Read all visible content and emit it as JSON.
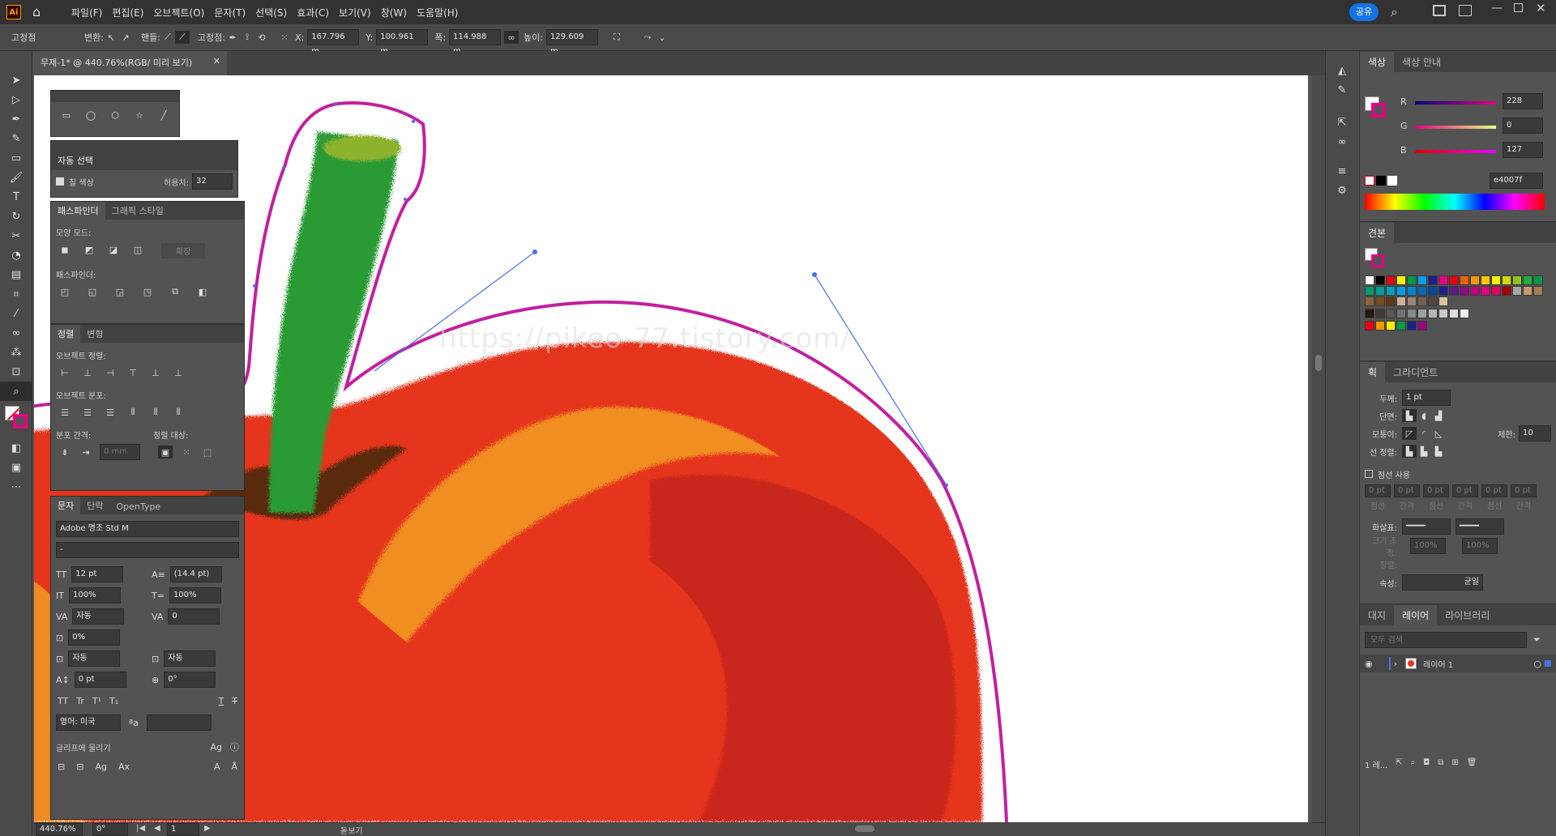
{
  "menubar": {
    "app_icon": "Ai",
    "items": [
      "파일(F)",
      "편집(E)",
      "오브젝트(O)",
      "문자(T)",
      "선택(S)",
      "효과(C)",
      "보기(V)",
      "창(W)",
      "도움말(H)"
    ],
    "share_label": "공유"
  },
  "control": {
    "mode": "고정점",
    "convert_label": "변환:",
    "handles_label": "핸들:",
    "anchor_label": "고정점:",
    "x_label": "X:",
    "x_value": "167.796 m",
    "y_label": "Y:",
    "y_value": "100.961 m",
    "w_label": "폭:",
    "w_value": "114.988 m",
    "h_label": "높이:",
    "h_value": "129.609 m"
  },
  "document": {
    "tab_title": "무제-1* @ 440.76%(RGB/ 미리 보기)",
    "watermark": "https://pikeo-77.tistory.com/"
  },
  "autoselect": {
    "title": "자동 선택",
    "fill_label": "칠 색상",
    "tolerance_label": "허용치:",
    "tolerance_value": "32"
  },
  "pathfinder": {
    "tab1": "패스파인더",
    "tab2": "그래픽 스타일",
    "shape_modes": "모양 모드:",
    "expand": "확장",
    "pathfinders": "패스파인더:"
  },
  "align": {
    "tab1": "정렬",
    "tab2": "변형",
    "align_objects": "오브젝트 정렬:",
    "distribute_objects": "오브젝트 분포:",
    "distribute_spacing": "분포 간격:",
    "align_to": "정렬 대상:",
    "spacing_value": "0 mm"
  },
  "character": {
    "tab1": "문자",
    "tab2": "단락",
    "tab3": "OpenType",
    "font_family": "Adobe 명조 Std M",
    "font_style": "-",
    "size": "12 pt",
    "leading": "(14.4 pt)",
    "v_scale": "100%",
    "h_scale": "100%",
    "kerning": "자동",
    "tracking": "0",
    "tsume": "0%",
    "aki_left": "자동",
    "aki_right": "자동",
    "baseline": "0 pt",
    "rotation": "0°",
    "language": "영어: 미국",
    "snap_label": "글리프에 물리기"
  },
  "status": {
    "zoom": "440.76%",
    "rotate": "0°",
    "artboard": "1",
    "tool_name": "돋보기"
  },
  "color_panel": {
    "tab1": "색상",
    "tab2": "색상 안내",
    "r_label": "R",
    "r_value": "228",
    "g_label": "G",
    "g_value": "0",
    "b_label": "B",
    "b_value": "127",
    "hex_value": "e4007f",
    "accent": "#e4007f"
  },
  "swatches_panel": {
    "title": "견본",
    "colors": [
      "#ffffff",
      "#000000",
      "#e60012",
      "#fff100",
      "#009944",
      "#00a0e9",
      "#1d2088",
      "#e4007f",
      "#e60012",
      "#eb6100",
      "#f39800",
      "#fcc800",
      "#fff100",
      "#cfdb00",
      "#8fc31f",
      "#22ac38",
      "#009944",
      "#009b6b",
      "#009e96",
      "#00a0c1",
      "#00a0e9",
      "#0086d1",
      "#0068b7",
      "#00479d",
      "#1d2088",
      "#601986",
      "#920783",
      "#be0081",
      "#e4007f",
      "#e5006a",
      "#a40000",
      "#a7a7a7",
      "#c69c6d",
      "#a67c52",
      "#8c6239",
      "#754c24",
      "#603913",
      "#c7b299",
      "#998675",
      "#736357",
      "#534741",
      "#d9c3a5"
    ],
    "grays": [
      "#231815",
      "#3e3a39",
      "#595757",
      "#727171",
      "#898989",
      "#9fa0a0",
      "#b5b5b6",
      "#c9caca",
      "#dcdddd",
      "#efefef"
    ],
    "group": [
      "#e60012",
      "#f39800",
      "#fff100",
      "#009944",
      "#1d2088",
      "#920783"
    ]
  },
  "stroke_panel": {
    "tab1": "획",
    "tab2": "그라디언트",
    "weight_label": "두께:",
    "weight_value": "1 pt",
    "cap_label": "단면:",
    "corner_label": "모퉁이:",
    "limit_label": "제한:",
    "limit_value": "10",
    "align_label": "선 정렬:",
    "dashed_label": "점선 사용",
    "dash_slots": [
      "0 pt",
      "0 pt",
      "0 pt",
      "0 pt",
      "0 pt",
      "0 pt"
    ],
    "dash_labels": [
      "점선",
      "간격",
      "점선",
      "간격",
      "점선",
      "간격"
    ],
    "arrow_label": "화살표:",
    "scale_label": "크기 조정:",
    "scale_a": "100%",
    "scale_b": "100%",
    "align_arrow_label": "정렬:",
    "profile_label": "속성:",
    "profile_value": "균일"
  },
  "layers_panel": {
    "tab1": "대지",
    "tab2": "레이어",
    "tab3": "라이브러리",
    "search_placeholder": "모두 검색",
    "layer_name": "레이어 1",
    "footer": "1 레..."
  }
}
